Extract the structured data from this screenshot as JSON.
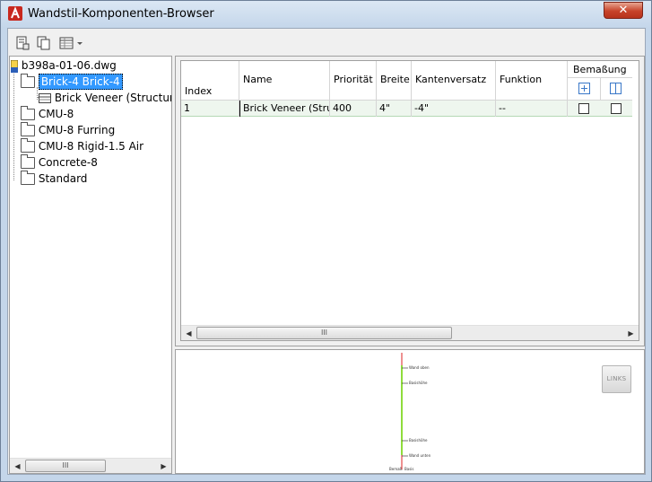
{
  "window": {
    "title": "Wandstil-Komponenten-Browser",
    "close_label": "✕"
  },
  "toolbar": {
    "buttons": [
      "new-style-icon",
      "copy-icon",
      "table-view-icon"
    ]
  },
  "tree": {
    "root": "b398a-01-06.dwg",
    "items": [
      {
        "label": "Brick-4 Brick-4",
        "selected": true
      },
      {
        "label": "Brick Veneer (Structural)",
        "child": true
      },
      {
        "label": "CMU-8"
      },
      {
        "label": "CMU-8 Furring"
      },
      {
        "label": "CMU-8 Rigid-1.5 Air"
      },
      {
        "label": "Concrete-8"
      },
      {
        "label": "Standard"
      }
    ]
  },
  "grid": {
    "columns": {
      "index": "Index",
      "name": "Name",
      "priority": "Priorität",
      "width": "Breite",
      "edge_offset": "Kantenversatz",
      "function": "Funktion",
      "dimension": "Bemaßung"
    },
    "rows": [
      {
        "index": "1",
        "name": "Brick Veneer (Stru...",
        "priority": "400",
        "width": "4\"",
        "edge_offset": "-4\"",
        "function": "--"
      }
    ],
    "scroll_grip": "III"
  },
  "preview": {
    "button_label": "LINKS",
    "annotations": [
      "Wand oben",
      "Basishöhe",
      "Basishöhe",
      "Wand unten"
    ],
    "axis_left": "Bemaß.",
    "axis_right": "Basis"
  },
  "tree_scroll_grip": "III"
}
